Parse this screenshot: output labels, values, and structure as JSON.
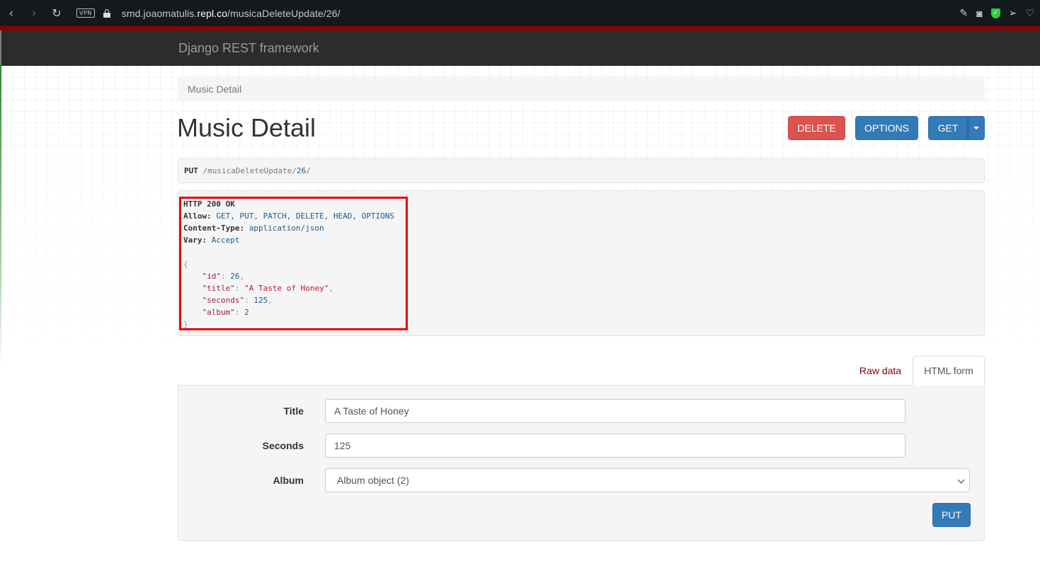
{
  "browser": {
    "back_icon": "‹",
    "forward_icon": "›",
    "reload_icon": "↻",
    "vpn_label": "VPN",
    "url_prefix": "smd.joaomatulis.",
    "url_domain": "repl.co",
    "url_path": "/musicaDeleteUpdate/26/"
  },
  "navbar": {
    "brand": "Django REST framework"
  },
  "breadcrumb": {
    "label": "Music Detail"
  },
  "page": {
    "title": "Music Detail"
  },
  "actions": {
    "delete": "DELETE",
    "options": "OPTIONS",
    "get": "GET"
  },
  "request": {
    "method": "PUT",
    "path_sep1": "/",
    "path_seg": "musicaDeleteUpdate",
    "path_sep2": "/",
    "path_id": "26",
    "path_sep3": "/"
  },
  "response": {
    "status": "HTTP 200 OK",
    "allow_key": "Allow:",
    "allow_val": "GET, PUT, PATCH, DELETE, HEAD, OPTIONS",
    "ctype_key": "Content-Type:",
    "ctype_val": "application/json",
    "vary_key": "Vary:",
    "vary_val": "Accept",
    "json": {
      "id_key": "\"id\"",
      "id_val": "26",
      "title_key": "\"title\"",
      "title_val": "\"A Taste of Honey\"",
      "seconds_key": "\"seconds\"",
      "seconds_val": "125",
      "album_key": "\"album\"",
      "album_val": "2"
    }
  },
  "tabs": {
    "raw": "Raw data",
    "html": "HTML form"
  },
  "form": {
    "title_label": "Title",
    "title_value": "A Taste of Honey",
    "seconds_label": "Seconds",
    "seconds_value": "125",
    "album_label": "Album",
    "album_value": "Album object (2)",
    "put_label": "PUT"
  },
  "colors": {
    "danger": "#d9534f",
    "primary": "#337ab7",
    "highlight": "#e8000b"
  }
}
